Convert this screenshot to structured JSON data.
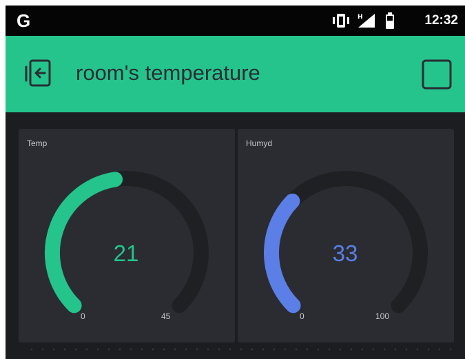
{
  "status_bar": {
    "google_letter": "G",
    "time": "12:32"
  },
  "header": {
    "title": "room's temperature"
  },
  "widgets": [
    {
      "label": "Temp",
      "value": "21",
      "min": "0",
      "max": "45",
      "color": "#24c48c"
    },
    {
      "label": "Humyd",
      "value": "33",
      "min": "0",
      "max": "100",
      "color": "#5b7fe6"
    }
  ],
  "colors": {
    "accent": "#24c48c",
    "background": "#1c1d21",
    "widget_bg": "#2b2c31",
    "gauge_track": "#1f2024"
  }
}
